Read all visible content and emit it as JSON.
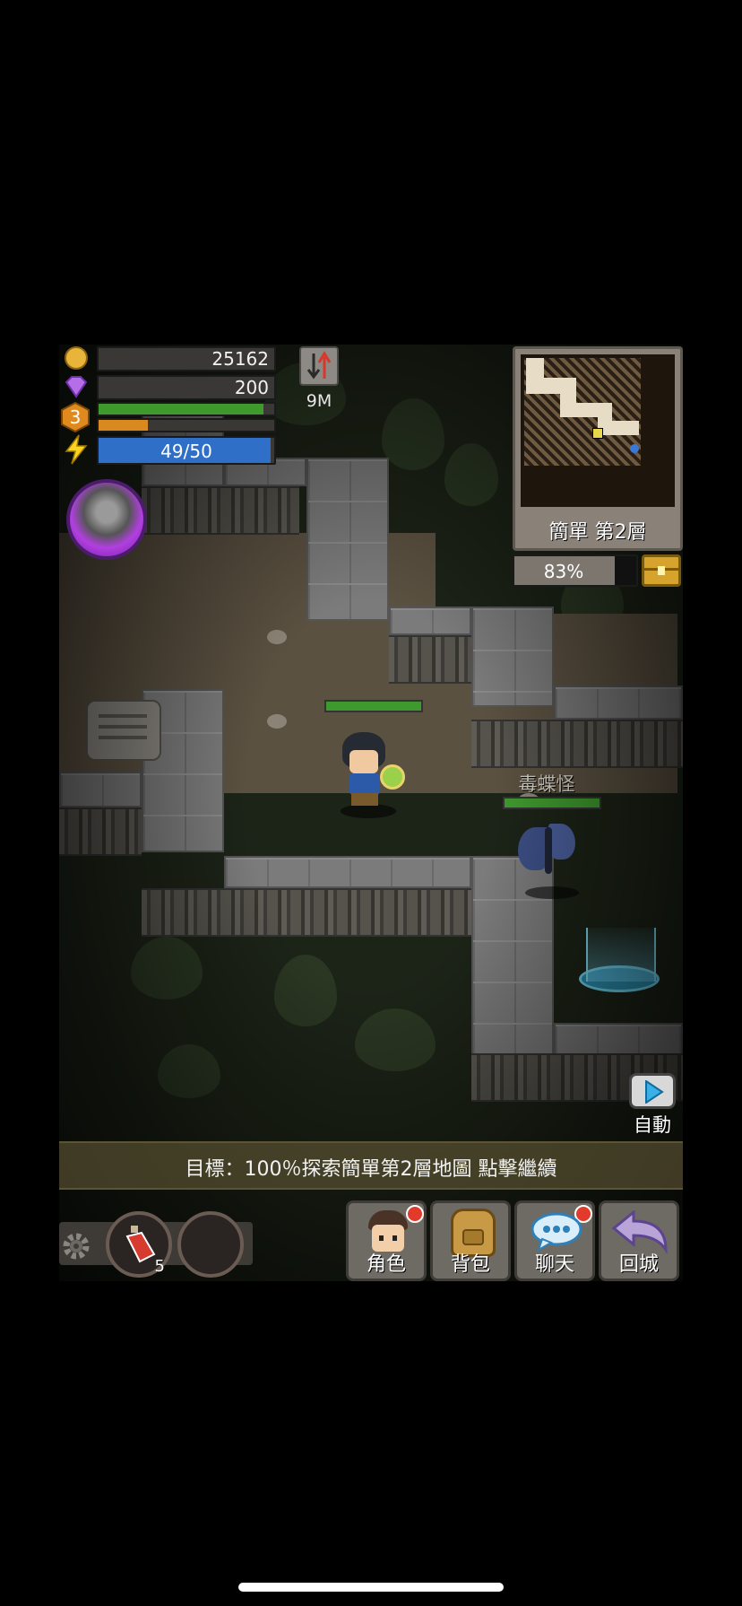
{
  "hud": {
    "gold": "25162",
    "gems": "200",
    "level": "3",
    "hp_fraction": 0.94,
    "exp_fraction": 0.28,
    "energy_text": "49/50",
    "energy_fraction": 0.98,
    "depth_label": "9M"
  },
  "minimap": {
    "floor_label": "簡單 第2層",
    "explore_percent": "83%"
  },
  "monster": {
    "name": "毒蝶怪"
  },
  "auto_label": "自動",
  "objective": "目標：100％探索簡單第2層地圖  點擊繼續",
  "items": {
    "potion_count": "5"
  },
  "menu": [
    {
      "label": "角色"
    },
    {
      "label": "背包"
    },
    {
      "label": "聊天"
    },
    {
      "label": "回城"
    }
  ],
  "colors": {
    "hp": "#3f9a2e",
    "exp": "#d98a1f",
    "energy": "#2f6fc7",
    "notification": "#e23b2b"
  }
}
